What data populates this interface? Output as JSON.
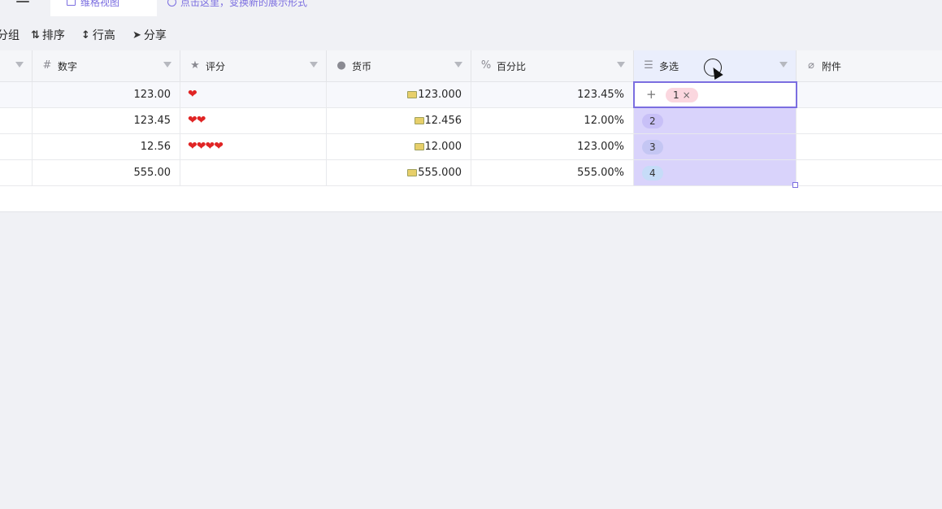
{
  "tabbar": {
    "active_tab_label": "维格视图",
    "tab_more": "···",
    "hint": "点击这里，变换新的展示形式"
  },
  "toolbar": {
    "group_label": "分组",
    "sort_label": "排序",
    "row_height_label": "行高",
    "share_label": "分享"
  },
  "columns": [
    {
      "label": "",
      "icon": "▾"
    },
    {
      "label": "数字",
      "icon": "#"
    },
    {
      "label": "评分",
      "icon": "★"
    },
    {
      "label": "货币",
      "icon": "money-bag-icon"
    },
    {
      "label": "百分比",
      "icon": "%"
    },
    {
      "label": "多选",
      "icon": "multi-select-icon"
    },
    {
      "label": "附件",
      "icon": "paperclip-icon"
    }
  ],
  "rows": [
    {
      "number": "123.00",
      "rating": "❤",
      "currency": "123.000",
      "percent": "123.45%",
      "multi": "1",
      "tag_color": "#fbd7df"
    },
    {
      "number": "123.45",
      "rating": "❤❤",
      "currency": "12.456",
      "percent": "12.00%",
      "multi": "2",
      "tag_color": "#c8c0f7"
    },
    {
      "number": "12.56",
      "rating": "❤❤❤❤",
      "currency": "12.000",
      "percent": "123.00%",
      "multi": "3",
      "tag_color": "#c4c6f3"
    },
    {
      "number": "555.00",
      "rating": "",
      "currency": "555.000",
      "percent": "555.00%",
      "multi": "4",
      "tag_color": "#c6dcf8"
    }
  ],
  "multi_add": "+",
  "tag_remove": "×",
  "colors": {
    "accent": "#7b6ee0",
    "rating": "#e02424",
    "multi_fill": "#d9d3fb"
  }
}
